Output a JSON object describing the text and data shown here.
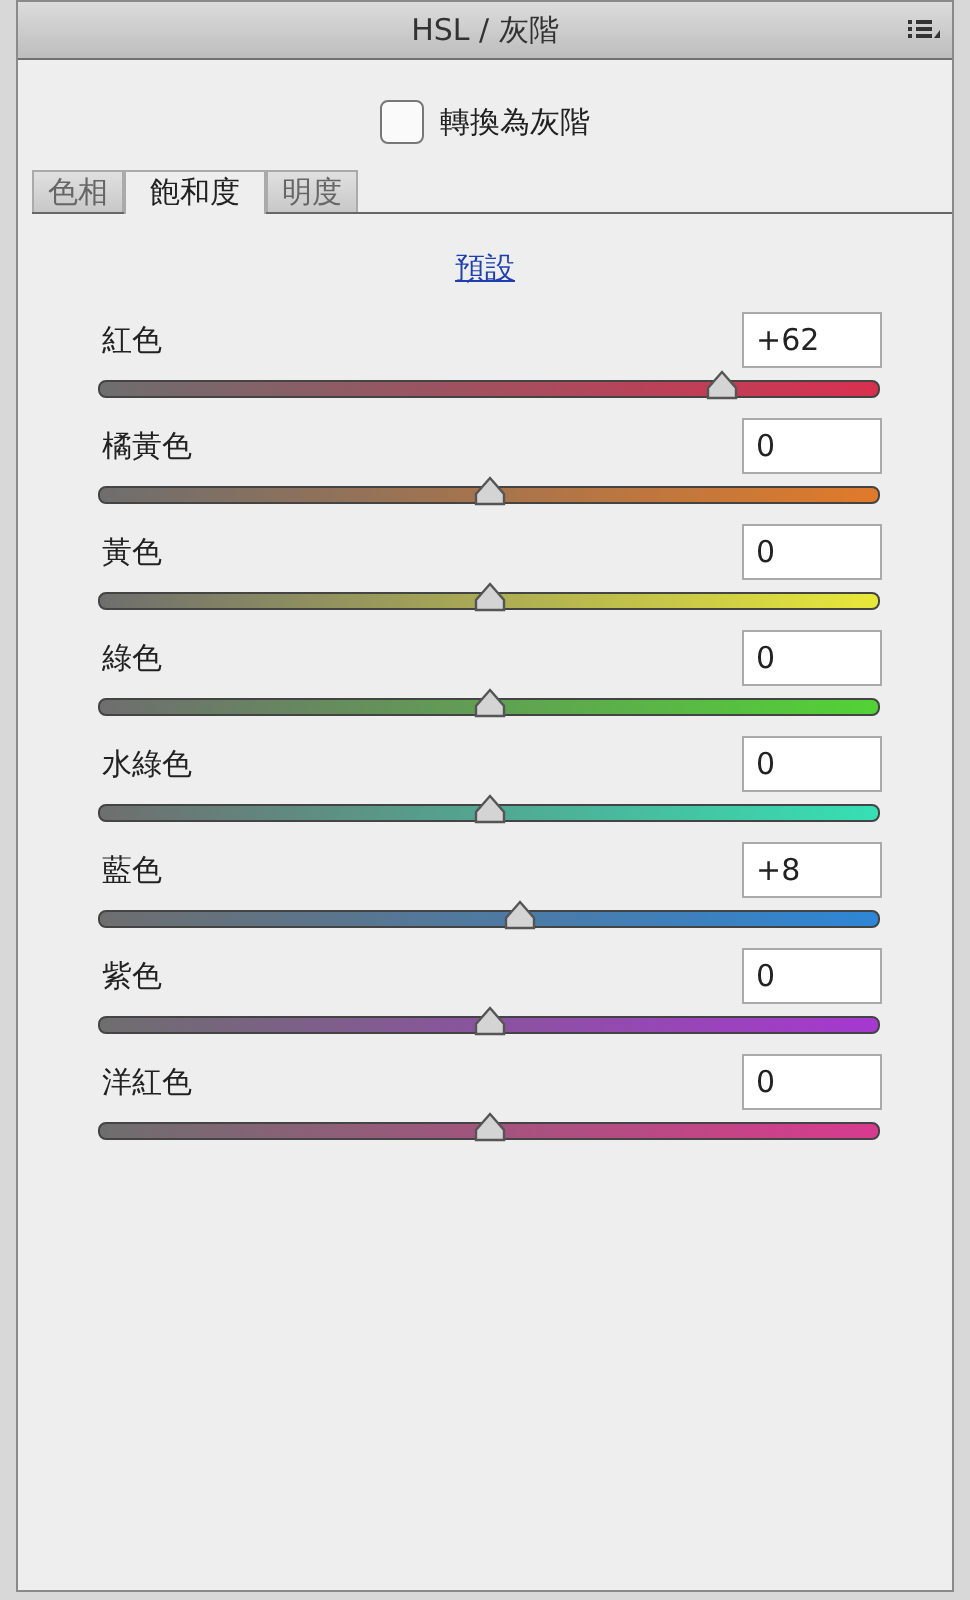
{
  "panel": {
    "title": "HSL / 灰階"
  },
  "convert_grayscale": {
    "label": "轉換為灰階",
    "checked": false
  },
  "tabs": [
    {
      "label": "色相",
      "selected": false
    },
    {
      "label": "飽和度",
      "selected": true
    },
    {
      "label": "明度",
      "selected": false
    }
  ],
  "default_link": "預設",
  "sliders": [
    {
      "name": "紅色",
      "value": "+62",
      "level": 0.81,
      "color": "#d8304f"
    },
    {
      "name": "橘黃色",
      "value": "0",
      "level": 0.5,
      "color": "#e07a2a"
    },
    {
      "name": "黃色",
      "value": "0",
      "level": 0.5,
      "color": "#e8e83a"
    },
    {
      "name": "綠色",
      "value": "0",
      "level": 0.5,
      "color": "#52d236"
    },
    {
      "name": "水綠色",
      "value": "0",
      "level": 0.5,
      "color": "#36e0b4"
    },
    {
      "name": "藍色",
      "value": "+8",
      "level": 0.54,
      "color": "#2e86d6"
    },
    {
      "name": "紫色",
      "value": "0",
      "level": 0.5,
      "color": "#a638d0"
    },
    {
      "name": "洋紅色",
      "value": "0",
      "level": 0.5,
      "color": "#d83a8e"
    }
  ]
}
